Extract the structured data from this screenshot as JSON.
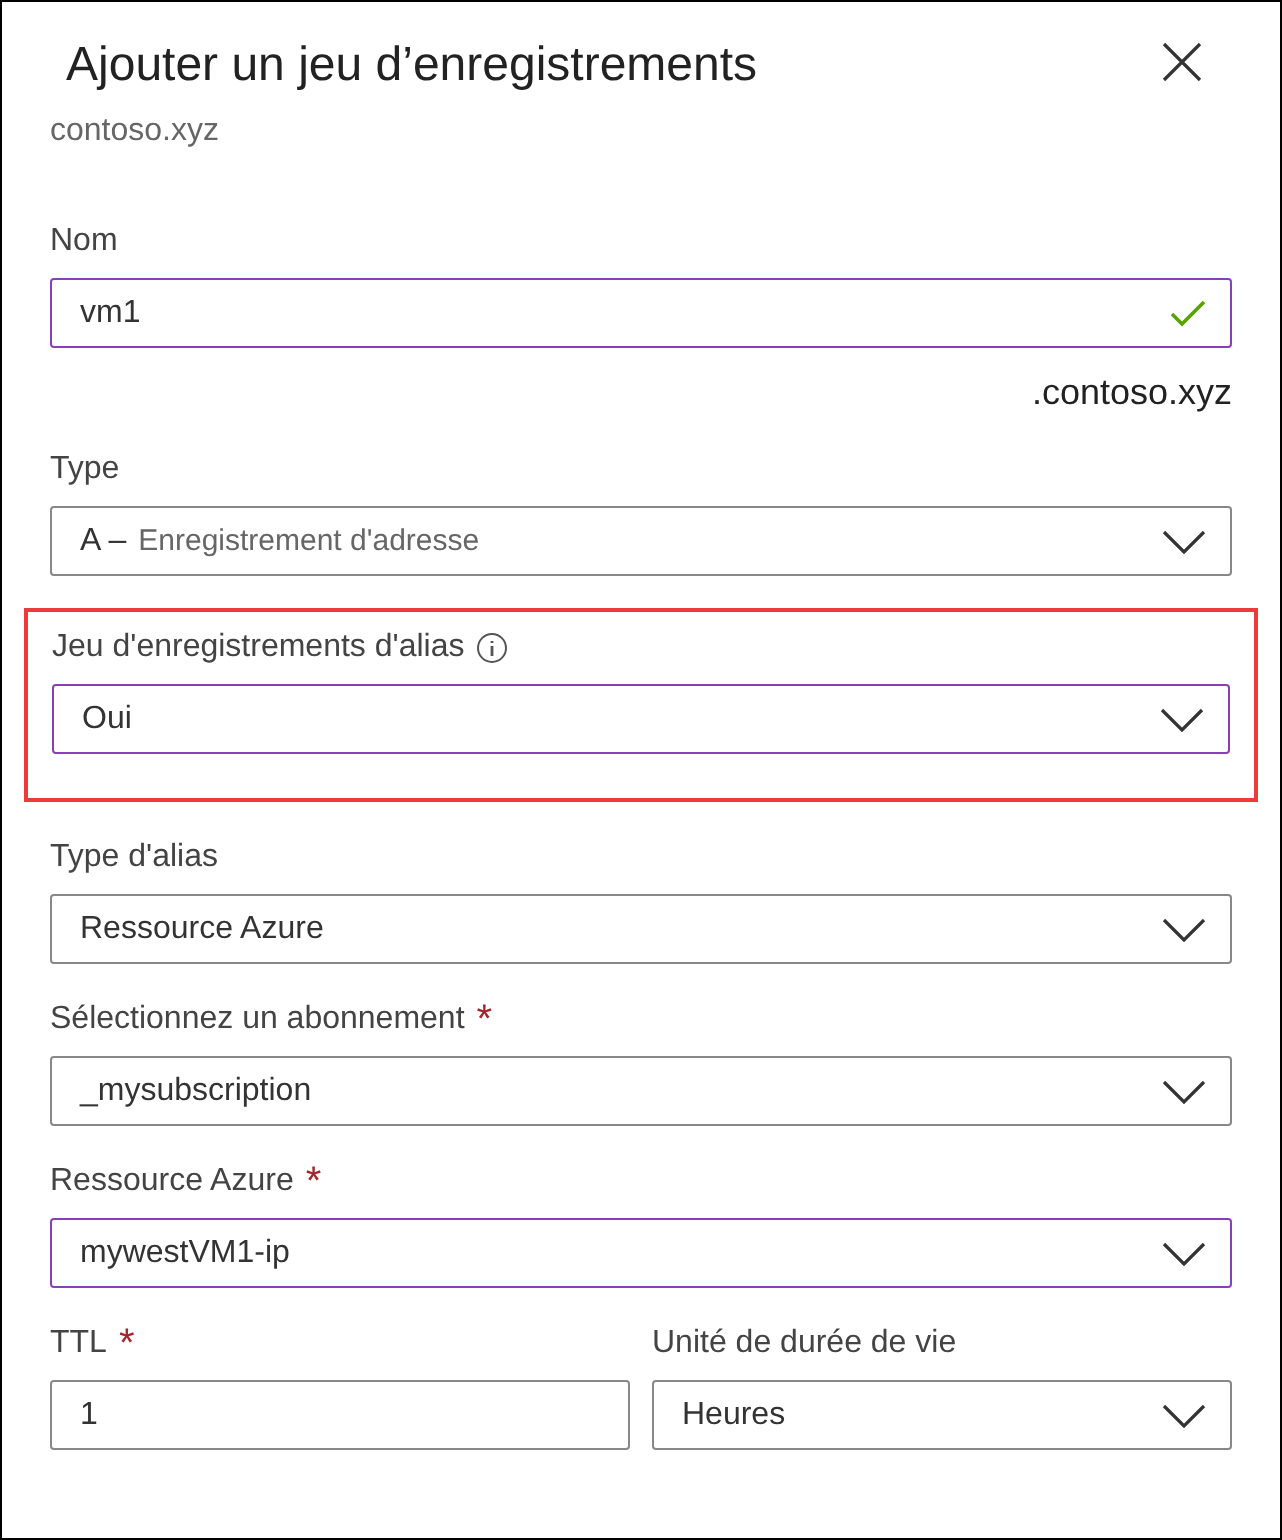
{
  "panel": {
    "title": "Ajouter un jeu d’enregistrements",
    "subtitle": "contoso.xyz"
  },
  "fields": [
    {
      "kind": "text",
      "label": "Nom",
      "value": "vm1",
      "focused": true,
      "valid": true,
      "suffix": ".contoso.xyz"
    },
    {
      "kind": "select",
      "label": "Type",
      "value": "A –",
      "value_detail": "Enregistrement d'adresse",
      "focused": false
    },
    {
      "kind": "select",
      "label": "Jeu d'enregistrements d'alias",
      "info": true,
      "value": "Oui",
      "focused": true,
      "highlighted": true
    },
    {
      "kind": "select",
      "label": "Type d'alias",
      "value": "Ressource Azure",
      "focused": false
    },
    {
      "kind": "select",
      "label": "Sélectionnez un abonnement",
      "required_mark": "*",
      "value": "_mysubscription",
      "focused": false
    },
    {
      "kind": "select",
      "label": "Ressource Azure",
      "required_mark": "*",
      "value": "mywestVM1-ip",
      "focused": true
    }
  ],
  "ttl": [
    {
      "kind": "text",
      "label": "TTL",
      "required_mark": "*",
      "value": "1",
      "focused": false
    },
    {
      "kind": "select",
      "label": "Unité de durée de vie",
      "value": "Heures",
      "focused": false
    }
  ]
}
